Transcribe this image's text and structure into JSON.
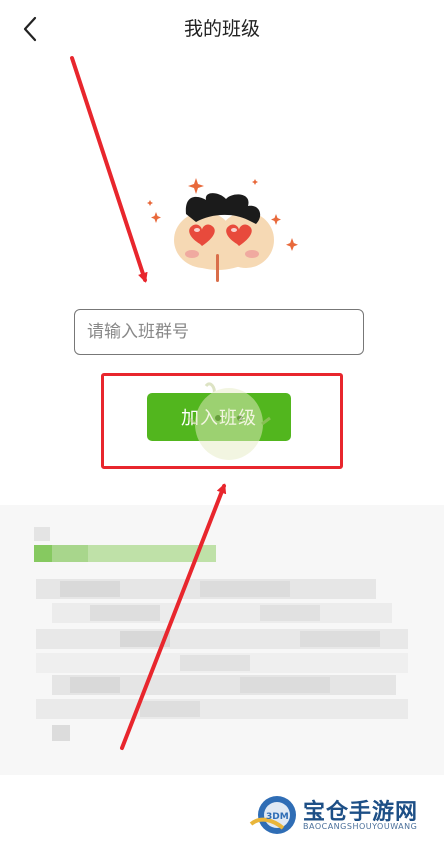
{
  "header": {
    "title": "我的班级"
  },
  "form": {
    "placeholder": "请输入班群号",
    "join_label": "加入班级"
  },
  "watermark": {
    "title": "宝仓手游网",
    "subtitle": "BAOCANGSHOUYOUWANG",
    "logo_text": "3DM"
  },
  "colors": {
    "accent": "#52b61e",
    "annotation": "#e8262d",
    "mascot_heart": "#e84a3c"
  }
}
